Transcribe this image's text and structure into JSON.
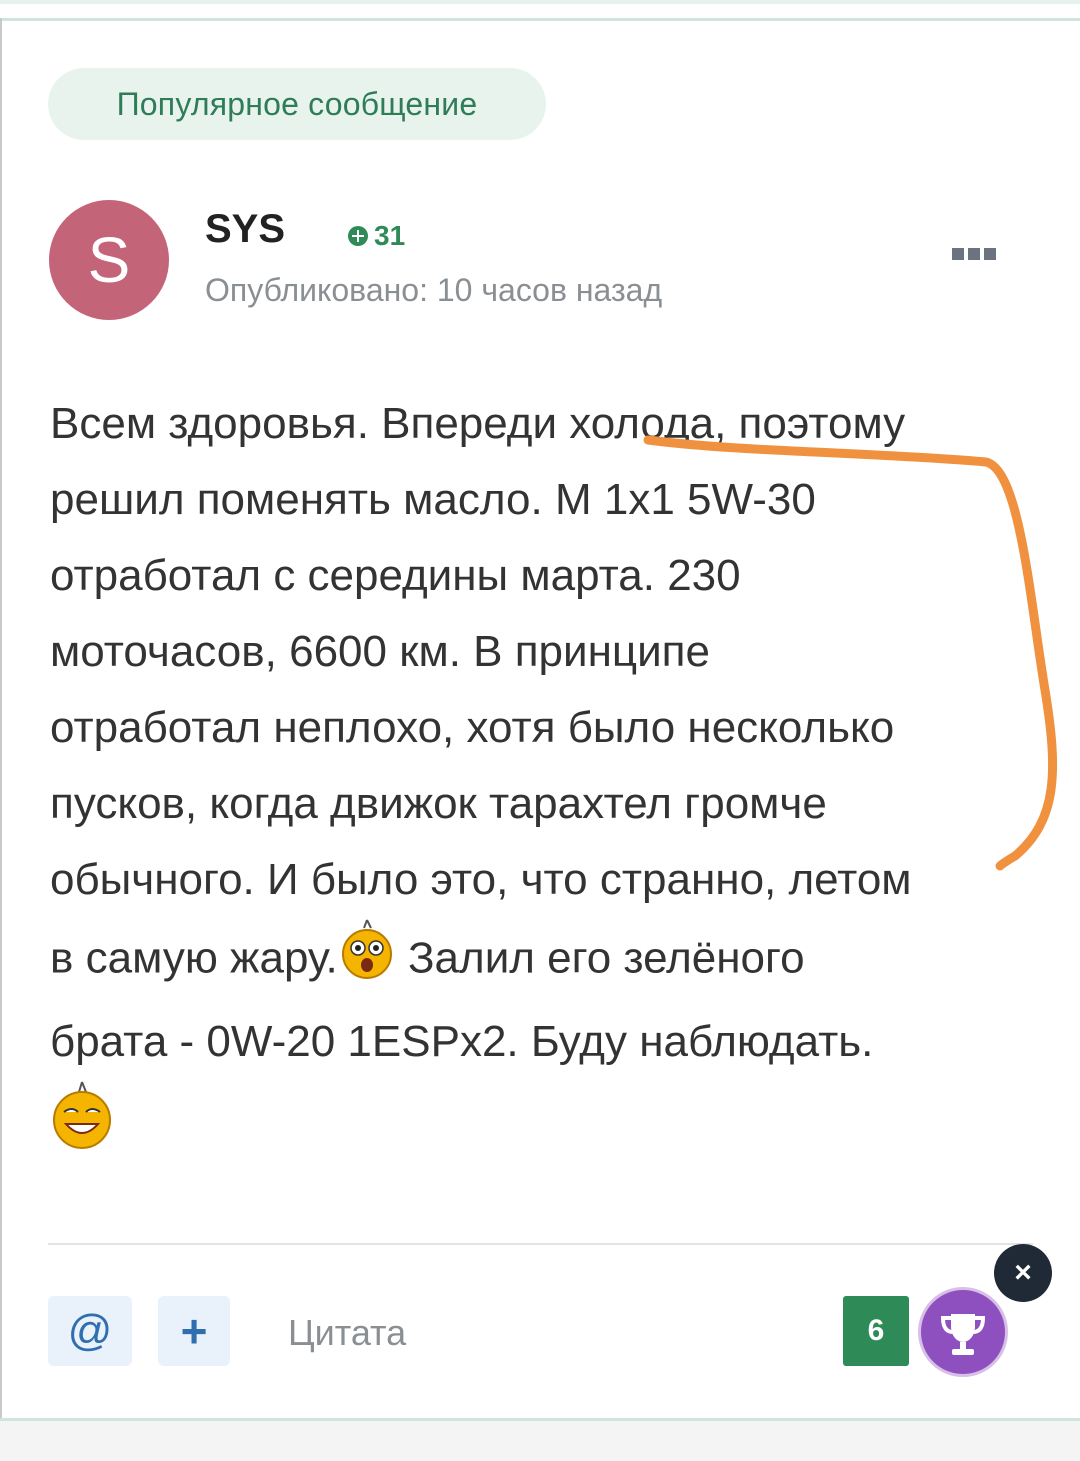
{
  "badge": {
    "label": "Популярное сообщение"
  },
  "author": {
    "avatar_letter": "S",
    "name": "SYS",
    "reputation": "31",
    "published": "Опубликовано: 10 часов назад"
  },
  "post": {
    "lines": [
      "Всем здоровья. Впереди холода, поэтому",
      "решил поменять масло. М 1х1 5W-30",
      "отработал с середины марта. 230",
      "моточасов, 6600 км. В принципе",
      "отработал неплохо, хотя было несколько",
      "пусков, когда движок тарахтел громче",
      "обычного. И было это, что странно, летом",
      "в самую жару.",
      " Залил его зелёного",
      "брата - 0W-20 1ESPx2. Буду наблюдать."
    ]
  },
  "actions": {
    "mention_label": "@",
    "plus_label": "+",
    "quote_label": "Цитата",
    "reaction_count": "6",
    "close_label": "×"
  },
  "icons": {
    "more": "more-icon",
    "reaction": "trophy-icon",
    "emoji1": "shocked-smiley-icon",
    "emoji2": "grinning-smiley-icon"
  },
  "colors": {
    "accent_green": "#2e8b57",
    "avatar_pink": "#c46479",
    "reaction_purple": "#8e4fbf",
    "highlight_orange": "#f0913f"
  }
}
